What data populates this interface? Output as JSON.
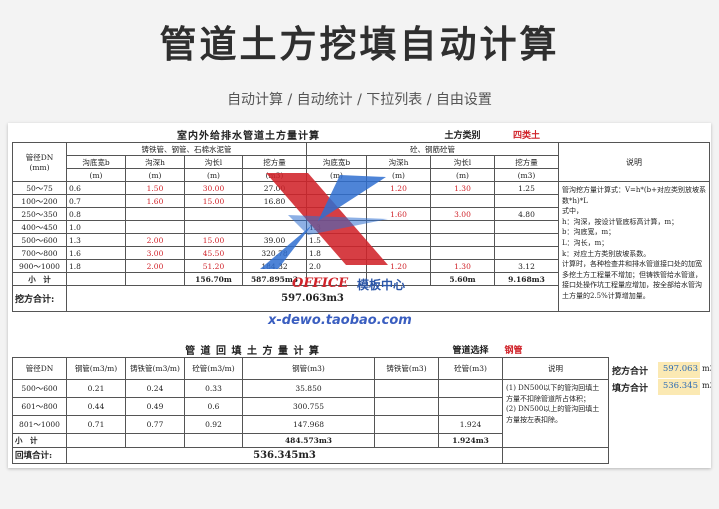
{
  "header": {
    "title": "管道土方挖填自动计算",
    "subtitle": "自动计算 / 自动统计 / 下拉列表 / 自由设置"
  },
  "t1": {
    "caption": "室内外给排水管道土方量计算",
    "soil_label": "土方类别",
    "soil_value": "四类土",
    "dn_header": "管径DN",
    "dn_unit": "(mm)",
    "group_cast": "铸铁管、钢管、石棉水泥管",
    "group_concrete": "砼、钢筋砼管",
    "col_width": "沟底宽b",
    "col_width_unit": "(m)",
    "col_depth": "沟深h",
    "col_depth_unit": "(m)",
    "col_length": "沟长l",
    "col_length_unit": "(m)",
    "col_volume": "挖方量",
    "col_volume_unit": "(m3)",
    "note_header": "说明",
    "note_text": "管沟挖方量计算式：V=h*(b+对应类别放坡系数*h)*L\n式中，\nh：沟深，按设计管底标高计算，m；\nb：沟底宽，m；\nL：沟长，m；\nk：对应土方类别放坡系数。\n计算时，各种检查井和排水管道接口处的加宽多挖土方工程量不增加；但铸铁管给水管道，接口处操作坑工程量应增加，按全部给水管沟土方量的2.5%计算增加量。",
    "rows": [
      {
        "dn": "50～75",
        "b1": "0.6",
        "h1": "1.50",
        "l1": "30.00",
        "v1": "27.00",
        "b2": "",
        "h2": "1.20",
        "l2": "1.30",
        "v2": "1.25"
      },
      {
        "dn": "100～200",
        "b1": "0.7",
        "h1": "1.60",
        "l1": "15.00",
        "v1": "16.80",
        "b2": "",
        "h2": "",
        "l2": "",
        "v2": ""
      },
      {
        "dn": "250～350",
        "b1": "0.8",
        "h1": "",
        "l1": "",
        "v1": "",
        "b2": "",
        "h2": "1.60",
        "l2": "3.00",
        "v2": "4.80"
      },
      {
        "dn": "400～450",
        "b1": "1.0",
        "h1": "",
        "l1": "",
        "v1": "",
        "b2": "1.3",
        "h2": "",
        "l2": "",
        "v2": ""
      },
      {
        "dn": "500～600",
        "b1": "1.3",
        "h1": "2.00",
        "l1": "15.00",
        "v1": "39.00",
        "b2": "1.5",
        "h2": "",
        "l2": "",
        "v2": ""
      },
      {
        "dn": "700～800",
        "b1": "1.6",
        "h1": "3.00",
        "l1": "45.50",
        "v1": "320.78",
        "b2": "1.8",
        "h2": "",
        "l2": "",
        "v2": ""
      },
      {
        "dn": "900～1000",
        "b1": "1.8",
        "h1": "2.00",
        "l1": "51.20",
        "v1": "184.32",
        "b2": "2.0",
        "h2": "1.20",
        "l2": "1.30",
        "v2": "3.12"
      }
    ],
    "subtotal_label": "小　计",
    "sub_l1": "156.70m",
    "sub_v1": "587.895m3",
    "sub_l2": "5.60m",
    "sub_v2": "9.168m3",
    "total_label": "挖方合计:",
    "total_value": "597.063m3"
  },
  "t2": {
    "caption": "管 道 回 填 土 方 量 计 算",
    "pipe_select_label": "管道选择",
    "pipe_select_value": "钢管",
    "col_dn": "管径DN",
    "col_steel_rate": "钢管(m3/m)",
    "col_cast_rate": "铸铁管(m3/m)",
    "col_concrete_rate": "砼管(m3/m)",
    "col_steel": "钢管(m3)",
    "col_cast": "铸铁管(m3)",
    "col_concrete": "砼管(m3)",
    "note_header": "说明",
    "note_text": "(1) DN500以下的管沟回填土方量不扣除管道所占体积；\n(2) DN500以上的管沟回填土方量按左表扣除。",
    "rows": [
      {
        "dn": "500～600",
        "r1": "0.21",
        "r2": "0.24",
        "r3": "0.33",
        "steel": "35.850",
        "concrete": ""
      },
      {
        "dn": "601～800",
        "r1": "0.44",
        "r2": "0.49",
        "r3": "0.6",
        "steel": "300.755",
        "concrete": ""
      },
      {
        "dn": "801～1000",
        "r1": "0.71",
        "r2": "0.77",
        "r3": "0.92",
        "steel": "147.968",
        "concrete": "1.924"
      }
    ],
    "subtotal_label": "小　计",
    "sub_steel": "484.573m3",
    "sub_concrete": "1.924m3",
    "total_label": "回填合计:",
    "total_value": "536.345m3"
  },
  "side": {
    "dig_label": "挖方合计",
    "dig_value": "597.063",
    "fill_label": "填方合计",
    "fill_value": "536.345",
    "unit": "m3"
  },
  "watermark": {
    "office": "OFFICE",
    "center": "模板中心",
    "url": "x-dewo.taobao.com"
  },
  "colors": {
    "red": "#d0232a",
    "blue": "#2d6cb5",
    "highlight": "#fbe9b3"
  }
}
